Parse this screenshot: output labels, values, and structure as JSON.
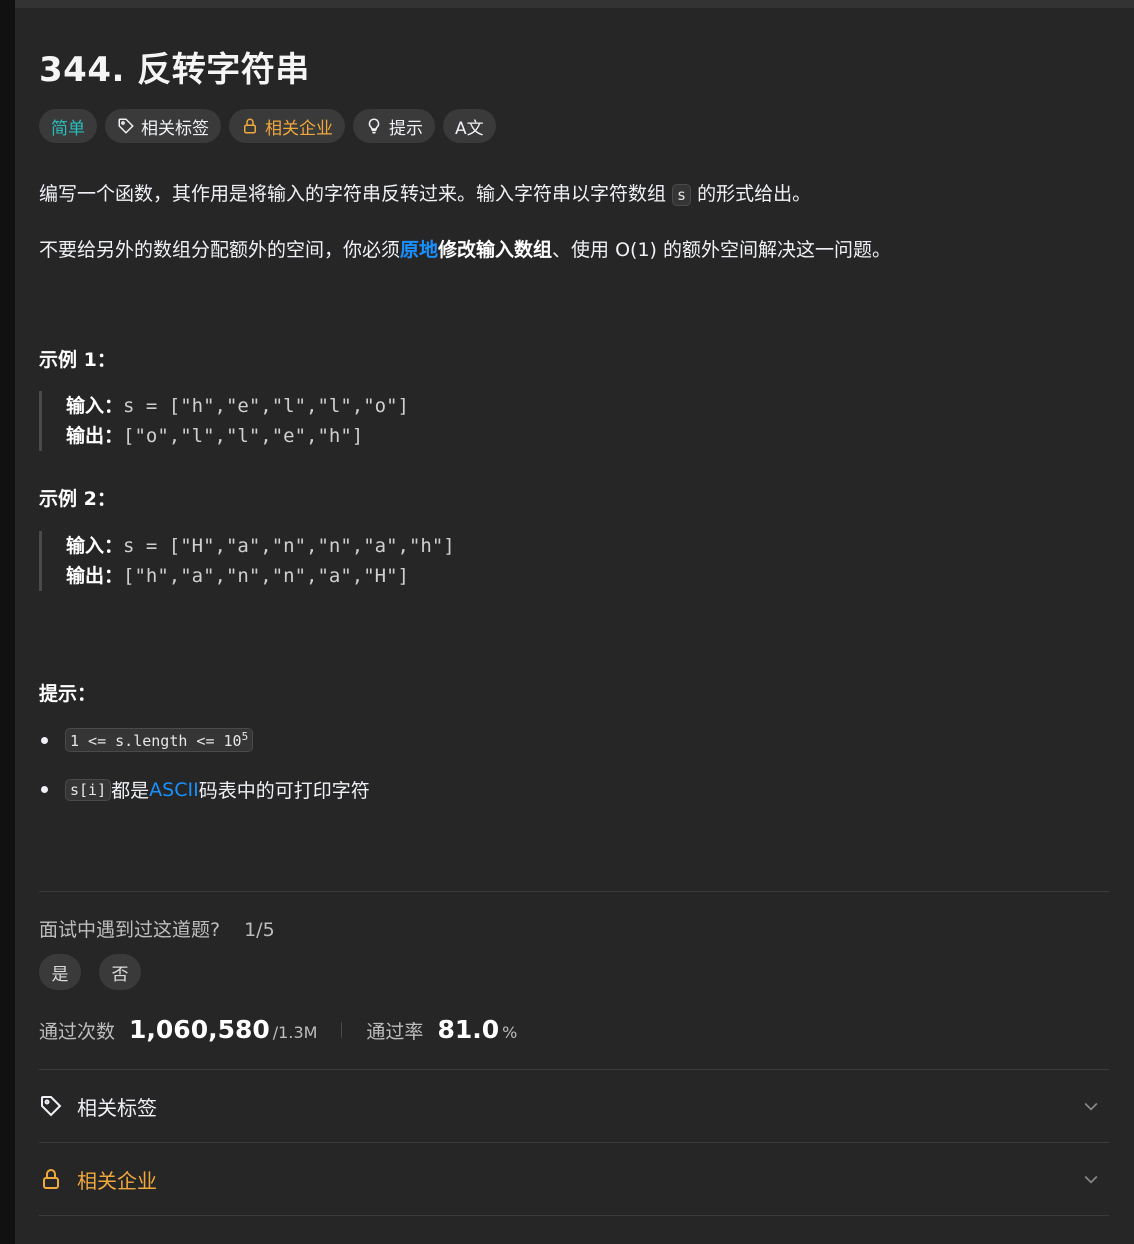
{
  "problem": {
    "title": "344. 反转字符串",
    "tags": {
      "difficulty": "简单",
      "related_tags": "相关标签",
      "related_companies": "相关企业",
      "hint": "提示",
      "translate": "A文"
    },
    "description": {
      "p1_before": "编写一个函数，其作用是将输入的字符串反转过来。输入字符串以字符数组 ",
      "p1_code": "s",
      "p1_after": " 的形式给出。",
      "p2_part1": "不要给另外的数组分配额外的空间，你必须",
      "p2_link": "原地",
      "p2_bold": "修改输入数组",
      "p2_part2": "、使用 O(1) 的额外空间解决这一问题。"
    },
    "examples": [
      {
        "title": "示例 1：",
        "input_label": "输入：",
        "input": "s = [\"h\",\"e\",\"l\",\"l\",\"o\"]",
        "output_label": "输出：",
        "output": "[\"o\",\"l\",\"l\",\"e\",\"h\"]"
      },
      {
        "title": "示例 2：",
        "input_label": "输入：",
        "input": "s = [\"H\",\"a\",\"n\",\"n\",\"a\",\"h\"]",
        "output_label": "输出：",
        "output": "[\"h\",\"a\",\"n\",\"n\",\"a\",\"H\"]"
      }
    ],
    "constraints": {
      "title": "提示：",
      "c1_code": "1 <= s.length <= 10",
      "c1_sup": "5",
      "c2_code": "s[i]",
      "c2_before": " 都是 ",
      "c2_link": "ASCII",
      "c2_after": " 码表中的可打印字符"
    }
  },
  "interview": {
    "question": "面试中遇到过这道题?",
    "count": "1/5",
    "yes": "是",
    "no": "否"
  },
  "stats": {
    "accepted_label": "通过次数",
    "accepted": "1,060,580",
    "submissions": "/1.3M",
    "rate_label": "通过率",
    "rate": "81.0",
    "rate_unit": "%"
  },
  "accordion": {
    "tags": "相关标签",
    "companies": "相关企业"
  },
  "colors": {
    "easy": "#2cbbbb",
    "company": "#f0a83c",
    "link": "#1a90ff",
    "background": "#262626"
  }
}
